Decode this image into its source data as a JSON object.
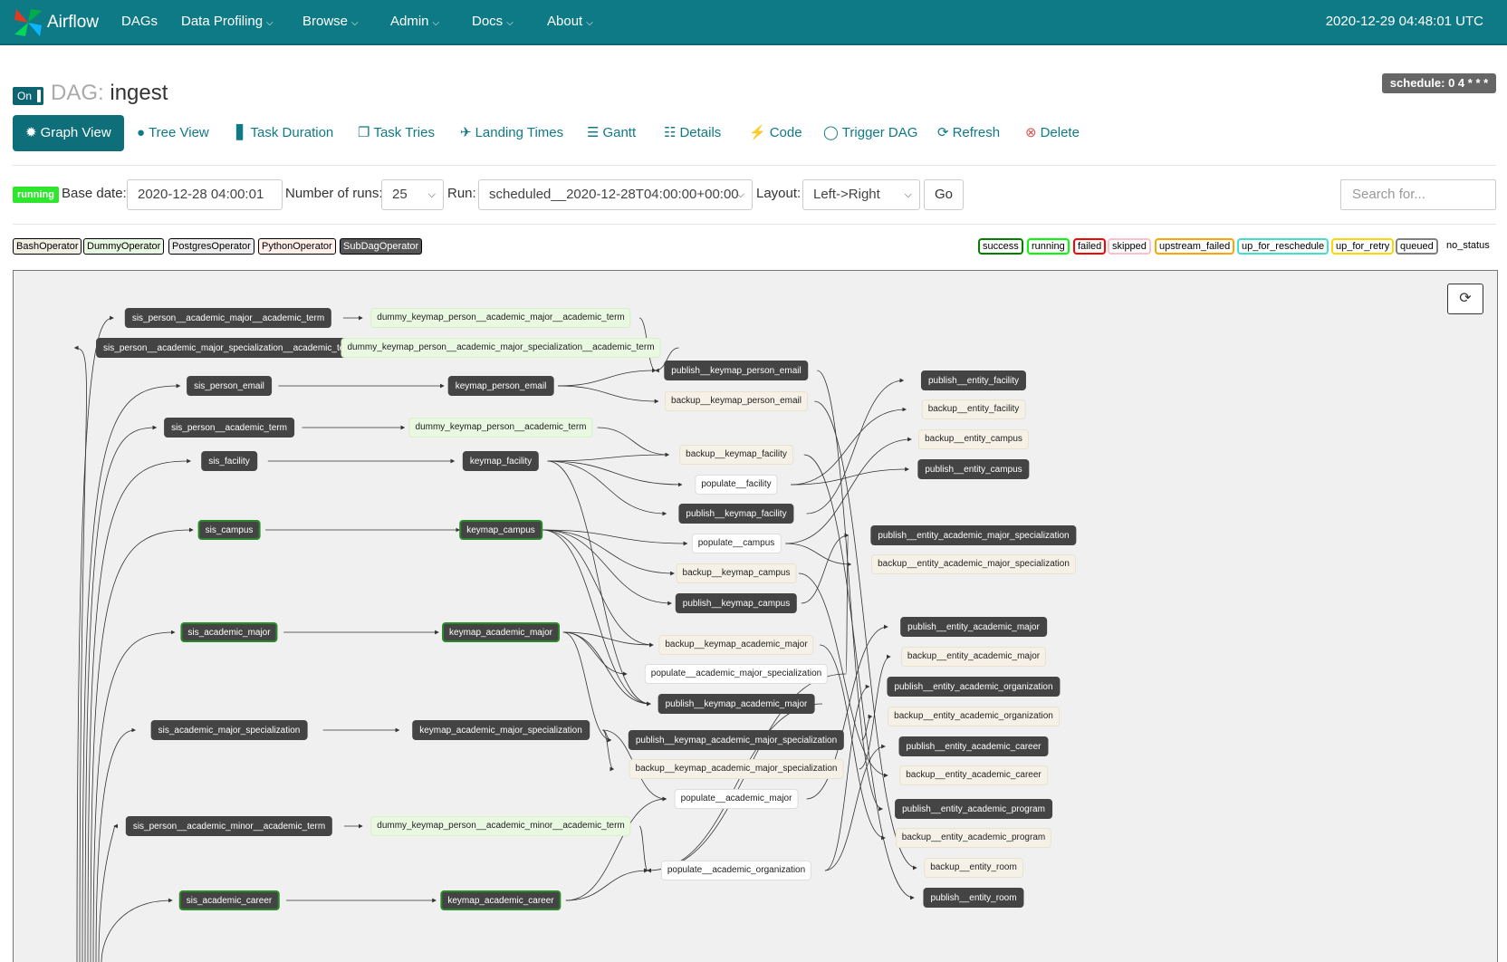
{
  "nav": {
    "brand": "Airflow",
    "items": [
      {
        "label": "DAGs",
        "dropdown": false
      },
      {
        "label": "Data Profiling",
        "dropdown": true
      },
      {
        "label": "Browse",
        "dropdown": true
      },
      {
        "label": "Admin",
        "dropdown": true
      },
      {
        "label": "Docs",
        "dropdown": true
      },
      {
        "label": "About",
        "dropdown": true
      }
    ],
    "clock": "2020-12-29 04:48:01 UTC"
  },
  "header": {
    "toggle": "On",
    "title_label": "DAG:",
    "dag_id": "ingest",
    "schedule": "schedule: 0 4 * * *"
  },
  "tabs": [
    {
      "label": "Graph View",
      "icon": "asterisk-icon",
      "active": true
    },
    {
      "label": "Tree View",
      "icon": "tree-icon"
    },
    {
      "label": "Task Duration",
      "icon": "bar-chart-icon"
    },
    {
      "label": "Task Tries",
      "icon": "duplicate-icon"
    },
    {
      "label": "Landing Times",
      "icon": "plane-icon"
    },
    {
      "label": "Gantt",
      "icon": "list-icon"
    },
    {
      "label": "Details",
      "icon": "list-alt-icon"
    },
    {
      "label": "Code",
      "icon": "flash-icon"
    },
    {
      "label": "Trigger DAG",
      "icon": "play-circle-icon"
    },
    {
      "label": "Refresh",
      "icon": "refresh-icon"
    },
    {
      "label": "Delete",
      "icon": "remove-circle-icon"
    }
  ],
  "form": {
    "state": "running",
    "base_date_label": "Base date:",
    "base_date": "2020-12-28 04:00:01",
    "num_runs_label": "Number of runs:",
    "num_runs": "25",
    "run_label": "Run:",
    "run": "scheduled__2020-12-28T04:00:00+00:00",
    "layout_label": "Layout:",
    "layout": "Left->Right",
    "go": "Go",
    "search_placeholder": "Search for..."
  },
  "operators": [
    {
      "label": "BashOperator",
      "bg": "#f0ede4",
      "fg": "#000"
    },
    {
      "label": "DummyOperator",
      "bg": "#e8f7e4",
      "fg": "#000"
    },
    {
      "label": "PostgresOperator",
      "bg": "#ededed",
      "fg": "#000"
    },
    {
      "label": "PythonOperator",
      "bg": "#ffefeb",
      "fg": "#000"
    },
    {
      "label": "SubDagOperator",
      "bg": "#555555",
      "fg": "#fff"
    }
  ],
  "statuses": [
    {
      "label": "success",
      "color": "#008000"
    },
    {
      "label": "running",
      "color": "#00ff00"
    },
    {
      "label": "failed",
      "color": "#ff0000"
    },
    {
      "label": "skipped",
      "color": "#ffc0cb"
    },
    {
      "label": "upstream_failed",
      "color": "#ffa500"
    },
    {
      "label": "up_for_reschedule",
      "color": "#40e0d0"
    },
    {
      "label": "up_for_retry",
      "color": "#ffd700"
    },
    {
      "label": "queued",
      "color": "#808080"
    }
  ],
  "no_status": "no_status",
  "graph": {
    "nodes": [
      {
        "id": "sis_person__academic_major__academic_term",
        "t": "sub"
      },
      {
        "id": "sis_person__academic_major_specialization__academic_term",
        "t": "sub"
      },
      {
        "id": "sis_person_email",
        "t": "sub"
      },
      {
        "id": "sis_person__academic_term",
        "t": "sub"
      },
      {
        "id": "sis_facility",
        "t": "sub"
      },
      {
        "id": "sis_campus",
        "t": "sub success"
      },
      {
        "id": "sis_academic_major",
        "t": "sub success"
      },
      {
        "id": "sis_academic_major_specialization",
        "t": "sub"
      },
      {
        "id": "sis_person__academic_minor__academic_term",
        "t": "sub"
      },
      {
        "id": "sis_academic_career",
        "t": "sub success"
      },
      {
        "id": "dummy_keymap_person__academic_major__academic_term",
        "t": "dm"
      },
      {
        "id": "dummy_keymap_person__academic_major_specialization__academic_term",
        "t": "dm"
      },
      {
        "id": "keymap_person_email",
        "t": "sub"
      },
      {
        "id": "dummy_keymap_person__academic_term",
        "t": "dm"
      },
      {
        "id": "keymap_facility",
        "t": "sub"
      },
      {
        "id": "keymap_campus",
        "t": "sub success"
      },
      {
        "id": "keymap_academic_major",
        "t": "sub success"
      },
      {
        "id": "keymap_academic_major_specialization",
        "t": "sub"
      },
      {
        "id": "dummy_keymap_person__academic_minor__academic_term",
        "t": "dm"
      },
      {
        "id": "keymap_academic_career",
        "t": "sub success"
      },
      {
        "id": "publish__keymap_person_email",
        "t": "sub"
      },
      {
        "id": "backup__keymap_person_email",
        "t": "pg"
      },
      {
        "id": "backup__keymap_facility",
        "t": "pg"
      },
      {
        "id": "populate__facility",
        "t": "py"
      },
      {
        "id": "publish__keymap_facility",
        "t": "sub"
      },
      {
        "id": "populate__campus",
        "t": "py"
      },
      {
        "id": "backup__keymap_campus",
        "t": "pg"
      },
      {
        "id": "publish__keymap_campus",
        "t": "sub"
      },
      {
        "id": "backup__keymap_academic_major",
        "t": "pg"
      },
      {
        "id": "populate__academic_major_specialization",
        "t": "py"
      },
      {
        "id": "publish__keymap_academic_major",
        "t": "sub"
      },
      {
        "id": "publish__keymap_academic_major_specialization",
        "t": "sub"
      },
      {
        "id": "backup__keymap_academic_major_specialization",
        "t": "pg"
      },
      {
        "id": "populate__academic_major",
        "t": "py"
      },
      {
        "id": "populate__academic_organization",
        "t": "py"
      },
      {
        "id": "publish__entity_facility",
        "t": "sub"
      },
      {
        "id": "backup__entity_facility",
        "t": "pg"
      },
      {
        "id": "backup__entity_campus",
        "t": "pg"
      },
      {
        "id": "publish__entity_campus",
        "t": "sub"
      },
      {
        "id": "publish__entity_academic_major_specialization",
        "t": "sub"
      },
      {
        "id": "backup__entity_academic_major_specialization",
        "t": "pg"
      },
      {
        "id": "publish__entity_academic_major",
        "t": "sub"
      },
      {
        "id": "backup__entity_academic_major",
        "t": "pg"
      },
      {
        "id": "publish__entity_academic_organization",
        "t": "sub"
      },
      {
        "id": "backup__entity_academic_organization",
        "t": "pg"
      },
      {
        "id": "publish__entity_academic_career",
        "t": "sub"
      },
      {
        "id": "backup__entity_academic_career",
        "t": "pg"
      },
      {
        "id": "publish__entity_academic_program",
        "t": "sub"
      },
      {
        "id": "backup__entity_academic_program",
        "t": "pg"
      },
      {
        "id": "backup__entity_room",
        "t": "pg"
      },
      {
        "id": "publish__entity_room",
        "t": "sub"
      }
    ]
  }
}
